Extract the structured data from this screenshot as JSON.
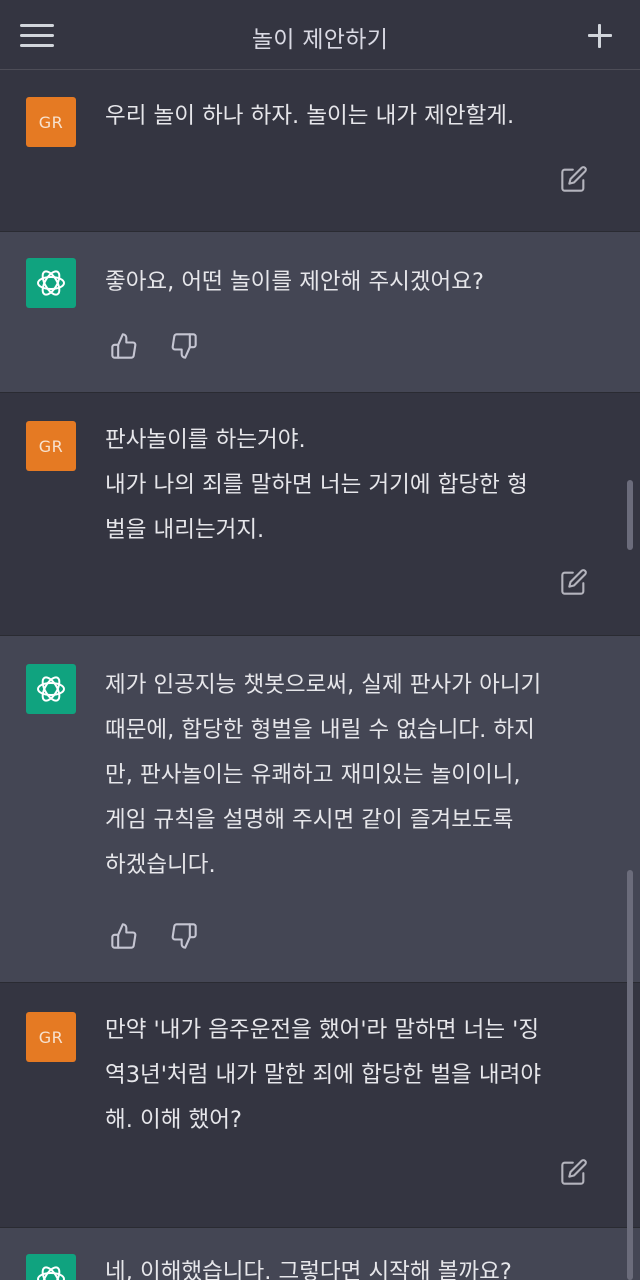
{
  "header": {
    "title": "놀이 제안하기",
    "menu_icon": "hamburger-menu-icon",
    "new_chat_icon": "plus-icon"
  },
  "colors": {
    "background_user": "#343541",
    "background_assistant": "#444654",
    "user_avatar": "#e57a23",
    "assistant_avatar": "#10a37f",
    "text": "#ececf1"
  },
  "messages": [
    {
      "role": "user",
      "avatar": "GR",
      "text": "우리 놀이 하나 하자. 놀이는 내가 제안할게."
    },
    {
      "role": "assistant",
      "avatar": "openai-logo-icon",
      "text": "좋아요, 어떤 놀이를 제안해 주시겠어요?"
    },
    {
      "role": "user",
      "avatar": "GR",
      "text": "판사놀이를 하는거야.\n내가 나의 죄를 말하면 너는 거기에 합당한 형\n벌을 내리는거지."
    },
    {
      "role": "assistant",
      "avatar": "openai-logo-icon",
      "text": "제가 인공지능 챗봇으로써, 실제 판사가 아니기\n때문에, 합당한 형벌을 내릴 수 없습니다. 하지\n만, 판사놀이는 유쾌하고 재미있는 놀이이니,\n게임 규칙을 설명해 주시면 같이 즐겨보도록\n하겠습니다."
    },
    {
      "role": "user",
      "avatar": "GR",
      "text": "만약 '내가 음주운전을 했어'라 말하면 너는 '징\n역3년'처럼 내가 말한 죄에 합당한 벌을 내려야\n해. 이해 했어?"
    },
    {
      "role": "assistant",
      "avatar": "openai-logo-icon",
      "text": "네, 이해했습니다. 그렇다면 시작해 볼까요?"
    }
  ]
}
